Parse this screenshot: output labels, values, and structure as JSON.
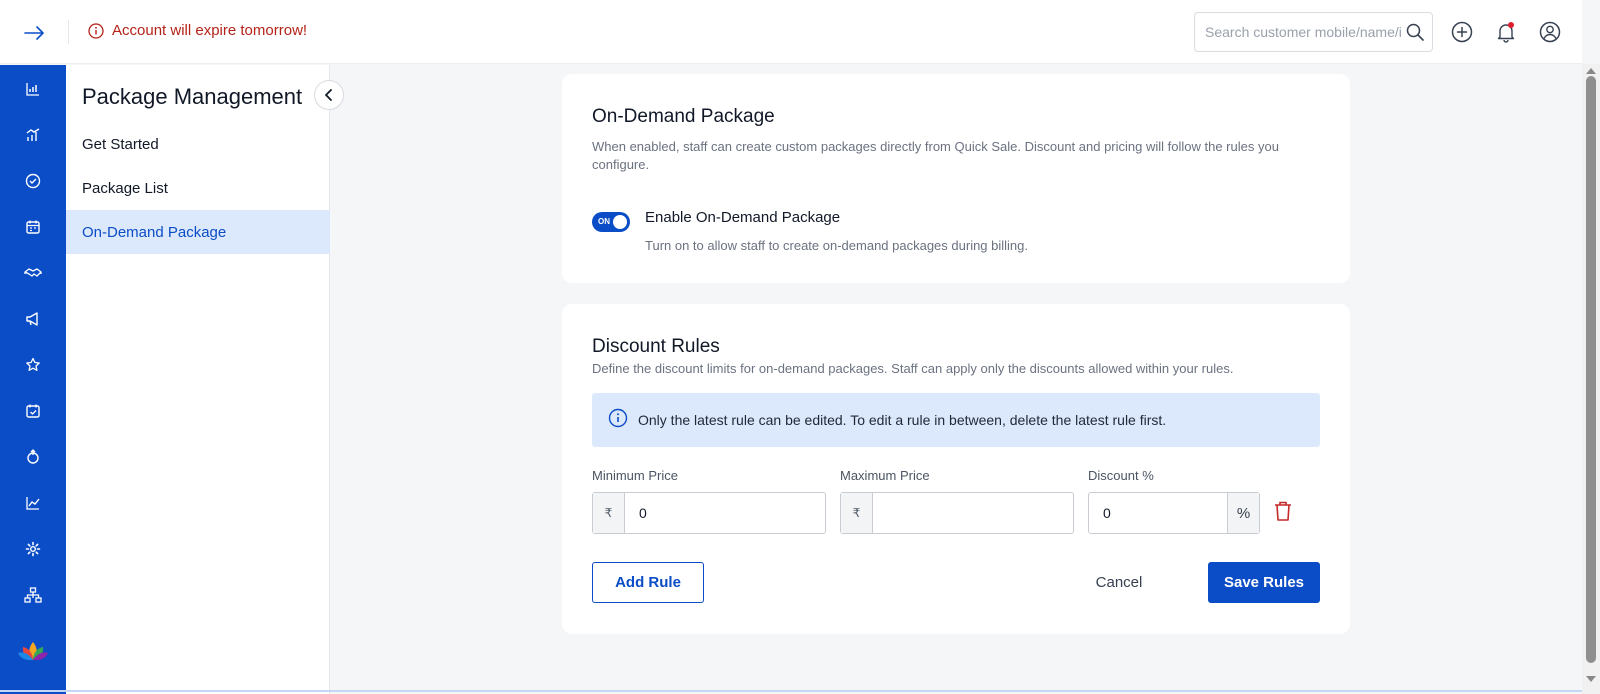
{
  "header": {
    "warning": "Account will expire tomorrow!",
    "search_placeholder": "Search customer mobile/name/id"
  },
  "sidebar": {
    "title": "Package Management",
    "items": [
      {
        "label": "Get Started",
        "active": false
      },
      {
        "label": "Package List",
        "active": false
      },
      {
        "label": "On-Demand Package",
        "active": true
      }
    ]
  },
  "rail_icons": [
    "bar-chart-icon",
    "analytics-icon",
    "check-circle-icon",
    "calendar-icon",
    "handshake-icon",
    "megaphone-icon",
    "star-icon",
    "calendar-check-icon",
    "loyalty-icon",
    "trend-icon",
    "gear-icon",
    "hierarchy-icon"
  ],
  "on_demand": {
    "title": "On-Demand Package",
    "description": "When enabled, staff can create custom packages directly from Quick Sale. Discount and pricing will follow the rules you configure.",
    "toggle_state": "ON",
    "toggle_label": "Enable On-Demand Package",
    "toggle_help": "Turn on to allow staff to create on-demand packages during billing."
  },
  "discount_rules": {
    "title": "Discount Rules",
    "description": "Define the discount limits for on-demand packages. Staff can apply only the discounts allowed within your rules.",
    "info": "Only the latest rule can be edited. To edit a rule in between, delete the latest rule first.",
    "min_price_label": "Minimum Price",
    "max_price_label": "Maximum Price",
    "discount_label": "Discount %",
    "currency_symbol": "₹",
    "percent_symbol": "%",
    "min_price_value": "0",
    "max_price_value": "",
    "discount_value": "0",
    "add_rule_label": "Add Rule",
    "cancel_label": "Cancel",
    "save_label": "Save Rules"
  },
  "colors": {
    "brand": "#0b4dc7",
    "warning": "#b42318",
    "info_bg": "#dce8fb"
  }
}
